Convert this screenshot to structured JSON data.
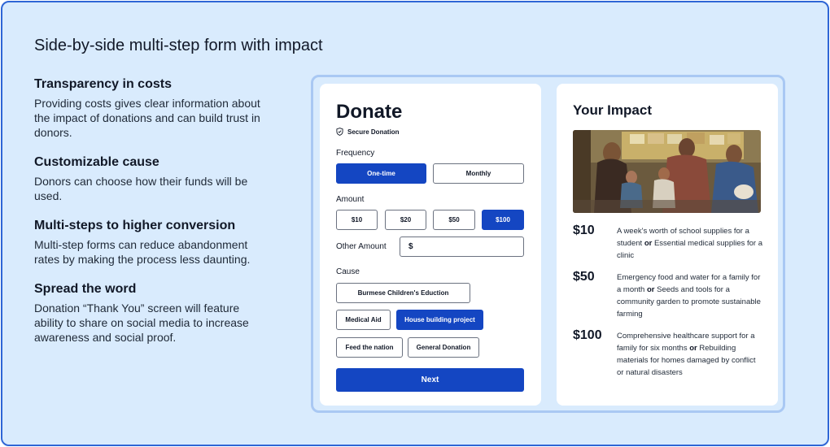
{
  "page": {
    "title": "Side-by-side multi-step form with impact"
  },
  "features": [
    {
      "title": "Transparency in costs",
      "text": "Providing costs gives clear information about the impact of donations and can build trust in donors."
    },
    {
      "title": "Customizable cause",
      "text": "Donors can choose how their funds will be used."
    },
    {
      "title": "Multi-steps to higher conversion",
      "text": "Multi-step forms can reduce abandonment rates by making the process less daunting."
    },
    {
      "title": "Spread the word",
      "text": "Donation “Thank You” screen will feature ability to share on social media to increase awareness and social proof."
    }
  ],
  "form": {
    "title": "Donate",
    "secure_label": "Secure Donation",
    "frequency_label": "Frequency",
    "frequency_options": [
      "One-time",
      "Monthly"
    ],
    "frequency_selected": "One-time",
    "amount_label": "Amount",
    "amount_options": [
      "$10",
      "$20",
      "$50",
      "$100"
    ],
    "amount_selected": "$100",
    "other_amount_label": "Other Amount",
    "other_amount_value": "$",
    "cause_label": "Cause",
    "cause_options": [
      "Burmese Children's Eduction",
      "Medical Aid",
      "House building project",
      "Feed the nation",
      "General Donation"
    ],
    "cause_selected": "House building project",
    "next_label": "Next"
  },
  "impact": {
    "title": "Your Impact",
    "tiers": [
      {
        "amount": "$10",
        "part1": "A week's worth of school supplies for a student",
        "or": "or",
        "part2": "Essential medical supplies for a clinic"
      },
      {
        "amount": "$50",
        "part1": "Emergency food and water for a family for a month",
        "or": "or",
        "part2": "Seeds and tools for a community garden to promote sustainable farming"
      },
      {
        "amount": "$100",
        "part1": "Comprehensive healthcare support for a family for six months",
        "or": "or",
        "part2": "Rebuilding materials for homes damaged by conflict or natural disasters"
      }
    ]
  },
  "colors": {
    "background": "#d9ebfd",
    "accent": "#1446c2",
    "frame_border": "#2f66d6"
  }
}
